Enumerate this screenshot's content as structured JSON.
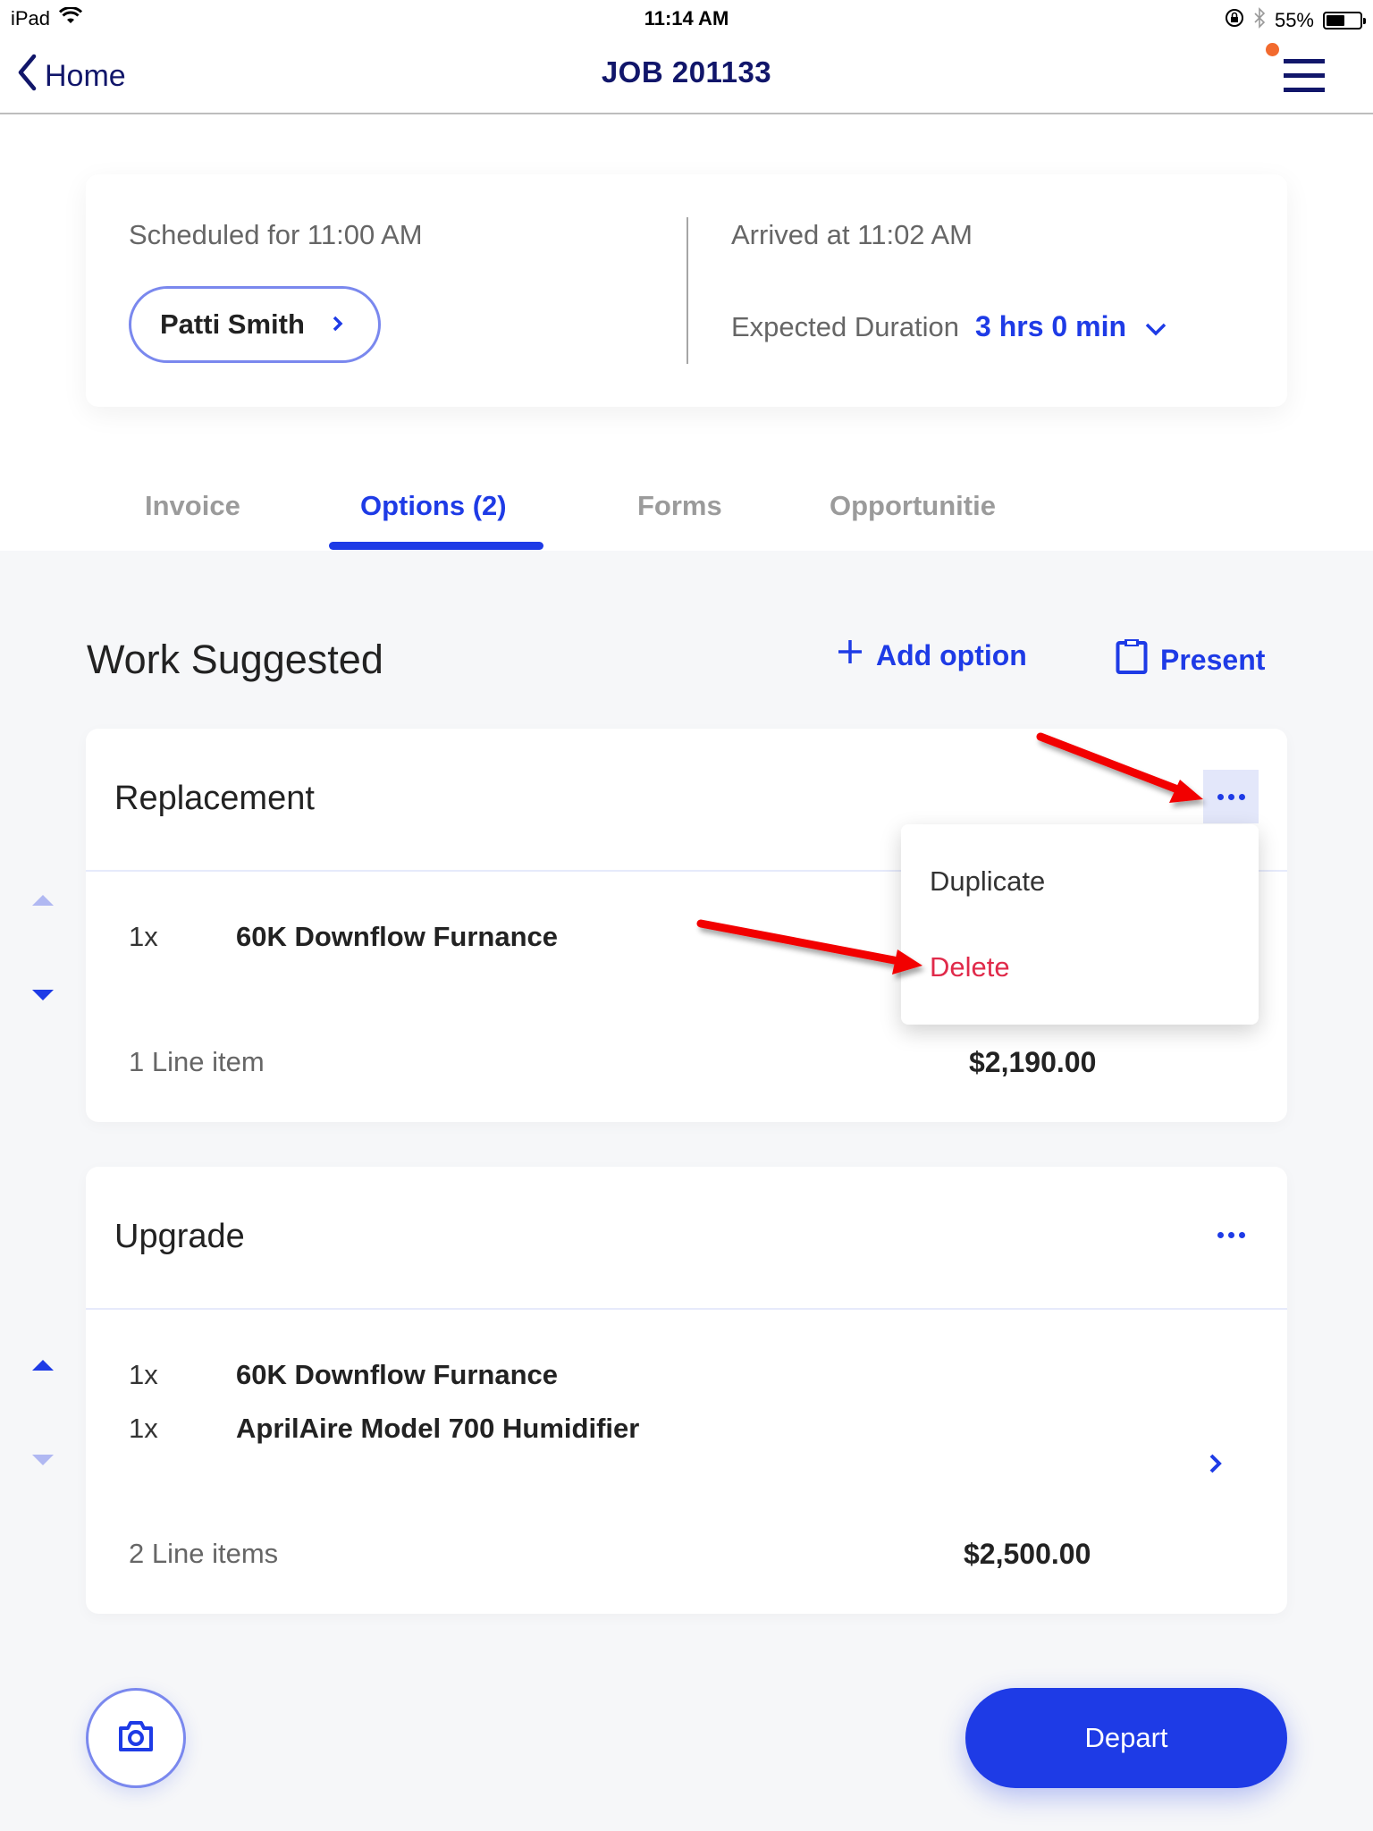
{
  "status_bar": {
    "device": "iPad",
    "time": "11:14 AM",
    "battery": "55%",
    "battery_level": 0.55,
    "icons": [
      "wifi-icon",
      "orientation-lock-icon",
      "bluetooth-icon",
      "battery-icon"
    ]
  },
  "nav": {
    "back_label": "Home",
    "title": "JOB 201133",
    "menu_icon": "hamburger-menu-icon",
    "has_notification": true
  },
  "job_info": {
    "scheduled": "Scheduled for 11:00 AM",
    "customer_name": "Patti Smith",
    "arrived": "Arrived at 11:02 AM",
    "duration_label": "Expected Duration",
    "duration_value": "3 hrs 0 min"
  },
  "tabs": [
    {
      "label": "Invoice",
      "active": false
    },
    {
      "label": "Options (2)",
      "active": true
    },
    {
      "label": "Forms",
      "active": false
    },
    {
      "label": "Opportunitie",
      "active": false
    }
  ],
  "section": {
    "title": "Work Suggested",
    "add_option_label": "Add option",
    "present_label": "Present"
  },
  "options": [
    {
      "title": "Replacement",
      "lines": [
        {
          "qty": "1x",
          "desc": "60K Downflow Furnance"
        }
      ],
      "summary": "1 Line item",
      "total": "$2,190.00",
      "menu_open": true
    },
    {
      "title": "Upgrade",
      "lines": [
        {
          "qty": "1x",
          "desc": "60K Downflow Furnance"
        },
        {
          "qty": "1x",
          "desc": "AprilAire Model 700 Humidifier"
        }
      ],
      "summary": "2 Line items",
      "total": "$2,500.00",
      "menu_open": false
    }
  ],
  "dropdown_menu": {
    "items": [
      {
        "label": "Duplicate"
      },
      {
        "label": "Delete",
        "destructive": true
      }
    ]
  },
  "footer": {
    "camera_icon": "camera-icon",
    "depart_label": "Depart"
  },
  "colors": {
    "accent": "#1e3be6",
    "nav_text": "#11166a",
    "destructive": "#e02a4a",
    "notification": "#f26a2e",
    "annotation_arrow": "#ff0000"
  }
}
